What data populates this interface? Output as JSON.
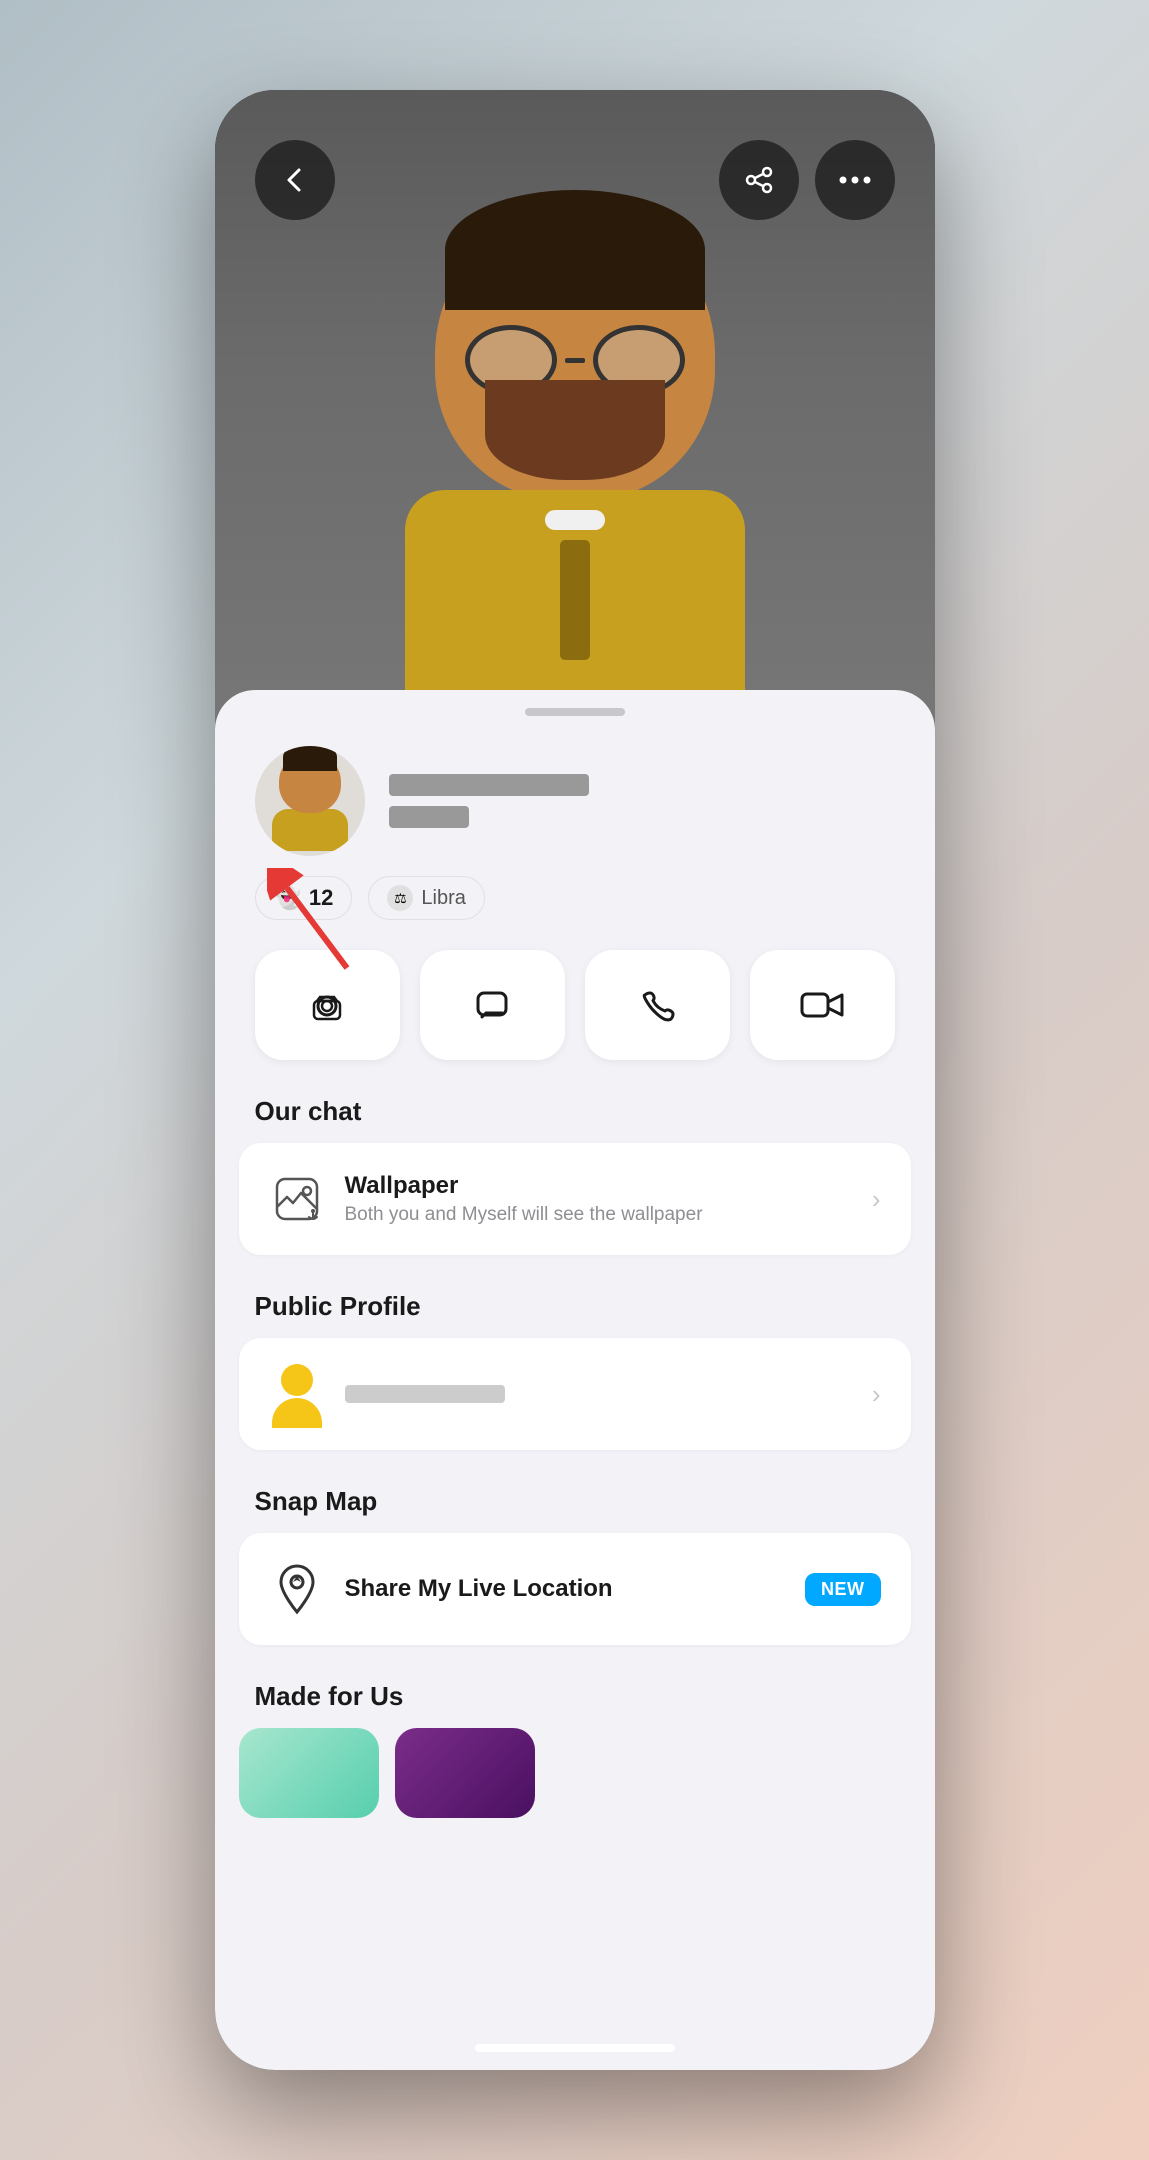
{
  "header": {
    "back_label": "‹",
    "share_label": "⎋",
    "more_label": "•••"
  },
  "profile": {
    "snap_score": "12",
    "zodiac": "Libra",
    "drag_handle_label": ""
  },
  "actions": [
    {
      "id": "camera",
      "icon": "⊙",
      "label": "Camera"
    },
    {
      "id": "chat",
      "icon": "💬",
      "label": "Chat"
    },
    {
      "id": "call",
      "icon": "📞",
      "label": "Call"
    },
    {
      "id": "video",
      "icon": "📹",
      "label": "Video"
    }
  ],
  "our_chat": {
    "section_title": "Our chat",
    "wallpaper": {
      "title": "Wallpaper",
      "subtitle": "Both you and Myself will see the wallpaper"
    }
  },
  "public_profile": {
    "section_title": "Public Profile"
  },
  "snap_map": {
    "section_title": "Snap Map",
    "share_location": {
      "title": "Share My Live Location",
      "badge": "NEW"
    }
  },
  "made_for_us": {
    "section_title": "Made for Us"
  }
}
